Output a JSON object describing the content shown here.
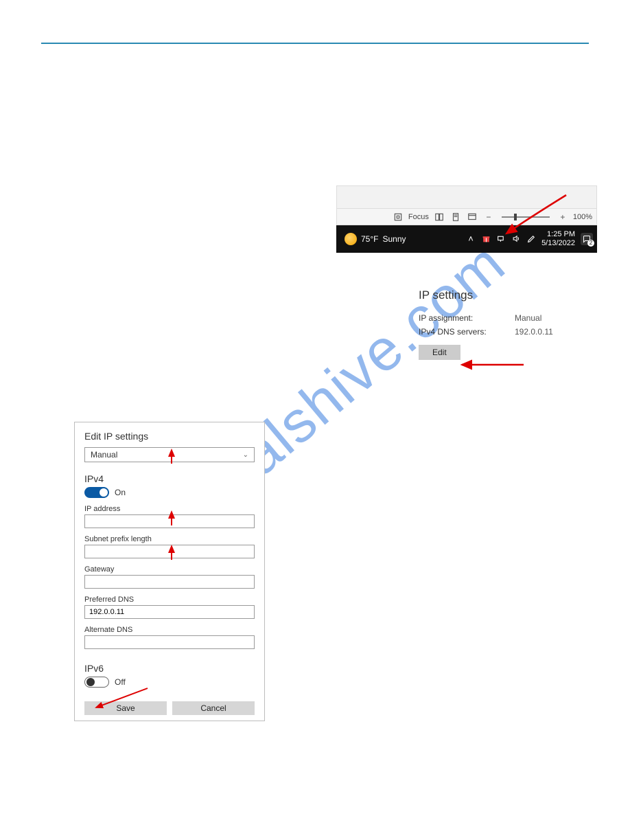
{
  "watermark": "manualshive.com",
  "office_toolbar": {
    "focus_label": "Focus",
    "zoom_pct": "100%"
  },
  "taskbar": {
    "temp": "75°F",
    "condition": "Sunny",
    "time": "1:25 PM",
    "date": "5/13/2022",
    "notif_count": "2"
  },
  "ip_settings": {
    "title": "IP settings",
    "assignment_label": "IP assignment:",
    "assignment_value": "Manual",
    "dns_label": "IPv4 DNS servers:",
    "dns_value": "192.0.0.11",
    "edit_label": "Edit"
  },
  "dialog": {
    "title": "Edit IP settings",
    "mode": "Manual",
    "ipv4_title": "IPv4",
    "on_label": "On",
    "ip_address_label": "IP address",
    "ip_address_value": "",
    "subnet_label": "Subnet prefix length",
    "subnet_value": "",
    "gateway_label": "Gateway",
    "gateway_value": "",
    "pref_dns_label": "Preferred DNS",
    "pref_dns_value": "192.0.0.11",
    "alt_dns_label": "Alternate DNS",
    "alt_dns_value": "",
    "ipv6_title": "IPv6",
    "off_label": "Off",
    "save_label": "Save",
    "cancel_label": "Cancel"
  }
}
